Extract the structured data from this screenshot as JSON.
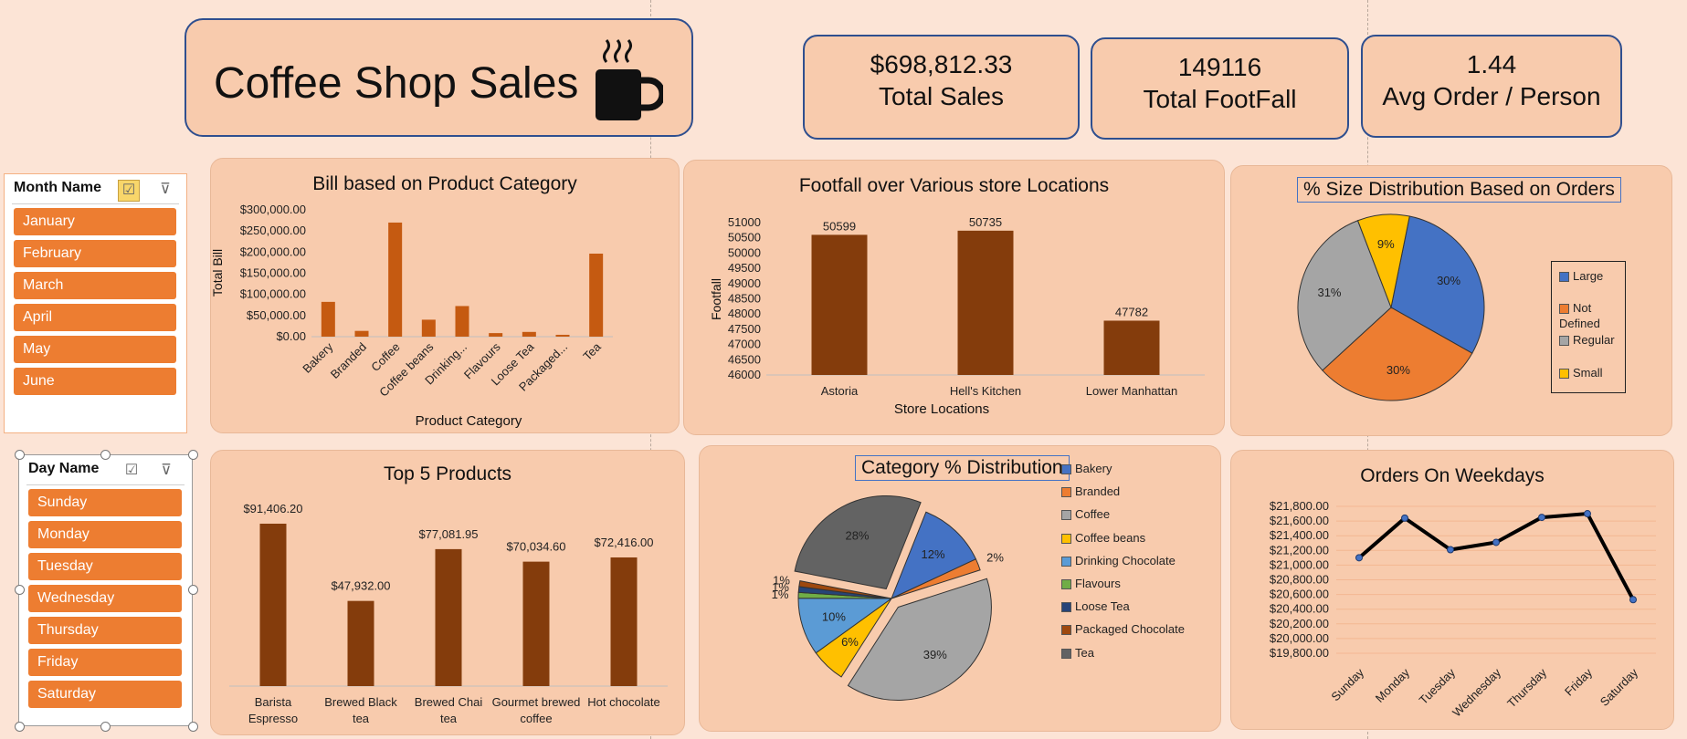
{
  "dashboard": {
    "title": "Coffee Shop Sales",
    "mug_icon": "coffee-mug-icon"
  },
  "kpis": [
    {
      "value": "$698,812.33",
      "label": "Total Sales"
    },
    {
      "value": "149116",
      "label": "Total FootFall"
    },
    {
      "value": "1.44",
      "label": "Avg Order / Person"
    }
  ],
  "slicers": {
    "month": {
      "title": "Month Name",
      "items": [
        "January",
        "February",
        "March",
        "April",
        "May",
        "June"
      ]
    },
    "day": {
      "title": "Day Name",
      "items": [
        "Sunday",
        "Monday",
        "Tuesday",
        "Wednesday",
        "Thursday",
        "Friday",
        "Saturday"
      ]
    },
    "colors": {
      "item": "#ed7d31"
    }
  },
  "chart_data": [
    {
      "id": "bill",
      "type": "bar",
      "title": "Bill based on Product Category",
      "xlabel": "Product Category",
      "ylabel": "Total Bill",
      "categories": [
        "Bakery",
        "Branded",
        "Coffee",
        "Coffee beans",
        "Drinking...",
        "Flavours",
        "Loose Tea",
        "Packaged...",
        "Tea"
      ],
      "values": [
        82300,
        13600,
        269900,
        40100,
        72400,
        8400,
        11200,
        4400,
        196400
      ],
      "ylim": [
        0,
        300000
      ],
      "ticks": [
        "$0.00",
        "$50,000.00",
        "$100,000.00",
        "$150,000.00",
        "$200,000.00",
        "$250,000.00",
        "$300,000.00"
      ],
      "color": "#c55a11"
    },
    {
      "id": "footfall",
      "type": "bar",
      "title": "Footfall over Various store Locations",
      "xlabel": "Store Locations",
      "ylabel": "Footfall",
      "categories": [
        "Astoria",
        "Hell's Kitchen",
        "Lower Manhattan"
      ],
      "values": [
        50599,
        50735,
        47782
      ],
      "labels": [
        "50599",
        "50735",
        "47782"
      ],
      "ylim": [
        46000,
        51000
      ],
      "ticks": [
        "46000",
        "46500",
        "47000",
        "47500",
        "48000",
        "48500",
        "49000",
        "49500",
        "50000",
        "50500",
        "51000"
      ],
      "color": "#843c0c"
    },
    {
      "id": "size",
      "type": "pie",
      "title": "% Size Distribution Based on Orders",
      "slices": [
        {
          "name": "Large",
          "value": 30,
          "label": "30%",
          "color": "#4472c4"
        },
        {
          "name": "Not Defined",
          "value": 30,
          "label": "30%",
          "color": "#ed7d31"
        },
        {
          "name": "Regular",
          "value": 31,
          "label": "31%",
          "color": "#a5a5a5"
        },
        {
          "name": "Small",
          "value": 9,
          "label": "9%",
          "color": "#ffc000"
        }
      ],
      "legend": [
        "Large",
        "Not Defined",
        "Regular",
        "Small"
      ]
    },
    {
      "id": "top5",
      "type": "bar",
      "title": "Top 5 Products",
      "categories": [
        "Barista Espresso",
        "Brewed Black tea",
        "Brewed Chai tea",
        "Gourmet brewed coffee",
        "Hot chocolate"
      ],
      "values": [
        91406.2,
        47932.0,
        77081.95,
        70034.6,
        72416.0
      ],
      "labels": [
        "$91,406.20",
        "$47,932.00",
        "$77,081.95",
        "$70,034.60",
        "$72,416.00"
      ],
      "color": "#843c0c"
    },
    {
      "id": "category",
      "type": "pie",
      "title": "Category % Distribution",
      "slices": [
        {
          "name": "Bakery",
          "value": 12,
          "label": "12%",
          "color": "#4472c4"
        },
        {
          "name": "Branded",
          "value": 2,
          "label": "2%",
          "color": "#ed7d31"
        },
        {
          "name": "Coffee",
          "value": 39,
          "label": "39%",
          "color": "#a5a5a5"
        },
        {
          "name": "Coffee beans",
          "value": 6,
          "label": "6%",
          "color": "#ffc000"
        },
        {
          "name": "Drinking Chocolate",
          "value": 10,
          "label": "10%",
          "color": "#5b9bd5"
        },
        {
          "name": "Flavours",
          "value": 1,
          "label": "1%",
          "color": "#70ad47"
        },
        {
          "name": "Loose Tea",
          "value": 1,
          "label": "1%",
          "color": "#264478"
        },
        {
          "name": "Packaged Chocolate",
          "value": 1,
          "label": "1%",
          "color": "#9e480e"
        },
        {
          "name": "Tea",
          "value": 28,
          "label": "28%",
          "color": "#636363"
        }
      ]
    },
    {
      "id": "weekdays",
      "type": "line",
      "title": "Orders On Weekdays",
      "categories": [
        "Sunday",
        "Monday",
        "Tuesday",
        "Wednesday",
        "Thursday",
        "Friday",
        "Saturday"
      ],
      "values": [
        21100,
        21640,
        21210,
        21310,
        21650,
        21700,
        20530
      ],
      "ylim": [
        19800,
        21800
      ],
      "ticks": [
        "$19,800.00",
        "$20,000.00",
        "$20,200.00",
        "$20,400.00",
        "$20,600.00",
        "$20,800.00",
        "$21,000.00",
        "$21,200.00",
        "$21,400.00",
        "$21,600.00",
        "$21,800.00"
      ],
      "color": "#000000",
      "marker_color": "#4472c4"
    }
  ]
}
